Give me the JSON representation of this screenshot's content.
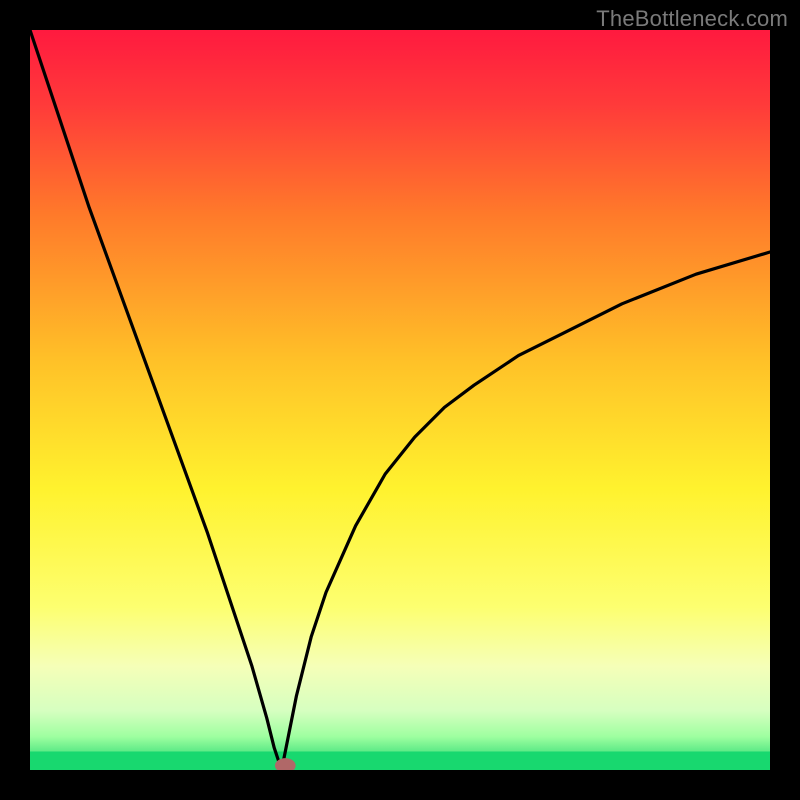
{
  "watermark": "TheBottleneck.com",
  "chart_data": {
    "type": "line",
    "title": "",
    "xlabel": "",
    "ylabel": "",
    "xlim": [
      0,
      100
    ],
    "ylim": [
      0,
      100
    ],
    "min_point": {
      "x": 34,
      "y": 0
    },
    "left_branch": {
      "x": [
        0,
        4,
        8,
        12,
        16,
        20,
        24,
        28,
        30,
        32,
        33,
        34
      ],
      "y": [
        100,
        88,
        76,
        65,
        54,
        43,
        32,
        20,
        14,
        7,
        3,
        0
      ]
    },
    "right_branch": {
      "x": [
        34,
        35,
        36,
        38,
        40,
        44,
        48,
        52,
        56,
        60,
        66,
        72,
        80,
        90,
        100
      ],
      "y": [
        0,
        5,
        10,
        18,
        24,
        33,
        40,
        45,
        49,
        52,
        56,
        59,
        63,
        67,
        70
      ]
    },
    "marker": {
      "x": 34.5,
      "y": 0.6,
      "color": "#b06868"
    },
    "gradient_stops": [
      {
        "offset": 0.0,
        "color": "#ff1a3f"
      },
      {
        "offset": 0.1,
        "color": "#ff3a3a"
      },
      {
        "offset": 0.25,
        "color": "#ff7a2a"
      },
      {
        "offset": 0.45,
        "color": "#ffc228"
      },
      {
        "offset": 0.62,
        "color": "#fff22e"
      },
      {
        "offset": 0.78,
        "color": "#fdff70"
      },
      {
        "offset": 0.86,
        "color": "#f5ffb8"
      },
      {
        "offset": 0.92,
        "color": "#d6ffc0"
      },
      {
        "offset": 0.955,
        "color": "#9effa0"
      },
      {
        "offset": 0.985,
        "color": "#3de07a"
      },
      {
        "offset": 1.0,
        "color": "#17d06a"
      }
    ],
    "green_cap_y": 2.5,
    "curve_color": "#000000",
    "curve_width": 3.2
  }
}
